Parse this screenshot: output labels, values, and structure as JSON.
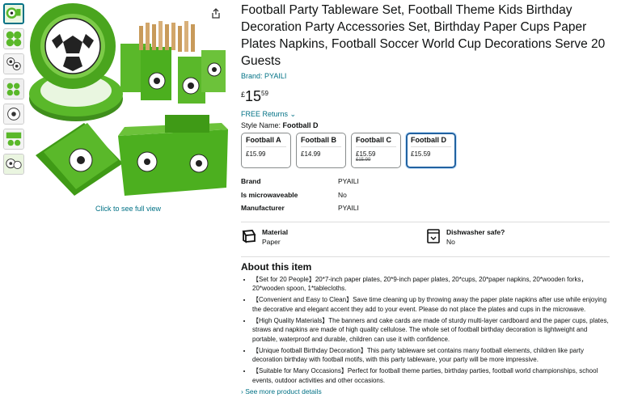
{
  "product": {
    "title": "Football Party Tableware Set, Football Theme Kids Birthday Decoration Party Accessories Set, Birthday Paper Cups Paper Plates Napkins, Football Soccer World Cup Decorations Serve 20 Guests",
    "brand_link": "Brand: PYAILI",
    "price": {
      "symbol": "£",
      "whole": "15",
      "fraction": "59"
    },
    "returns": "FREE Returns ⌄",
    "style_label": "Style Name: ",
    "style_value": "Football D"
  },
  "gallery": {
    "see_full_view": "Click to see full view",
    "thumbnail_count": 7,
    "active_thumbnail": 1
  },
  "options": [
    {
      "name": "Football A",
      "price": "£15.99",
      "was": ""
    },
    {
      "name": "Football B",
      "price": "£14.99",
      "was": ""
    },
    {
      "name": "Football C",
      "price": "£15.59",
      "was": "£15.99"
    },
    {
      "name": "Football D",
      "price": "£15.59",
      "was": ""
    }
  ],
  "specs": [
    {
      "key": "Brand",
      "value": "PYAILI"
    },
    {
      "key": "Is microwaveable",
      "value": "No"
    },
    {
      "key": "Manufacturer",
      "value": "PYAILI"
    }
  ],
  "features": [
    {
      "icon": "material-icon",
      "label": "Material",
      "value": "Paper"
    },
    {
      "icon": "dishwasher-icon",
      "label": "Dishwasher safe?",
      "value": "No"
    }
  ],
  "about": {
    "heading": "About this item",
    "bullets": [
      "【Set for 20 People】20*7-inch paper plates, 20*9-inch paper plates, 20*cups, 20*paper napkins, 20*wooden forks， 20*wooden spoon, 1*tablecloths.",
      "【Convenient and Easy to Clean】Save time cleaning up by throwing away the paper plate napkins after use while enjoying the decorative and elegant accent they add to your event. Please do not place the plates and cups in the microwave.",
      "【High Quality Materials】The banners and cake cards are made of sturdy multi-layer cardboard and the paper cups, plates, straws and napkins are made of high quality cellulose. The whole set of football birthday decoration is lightweight and portable, waterproof and durable, children can use it with confidence.",
      "【Unique football Birthday Decoration】This party tableware set contains many football elements, children like party decoration birthday with football motifs, with this party tableware, your party will be more impressive.",
      "【Suitable for Many Occasions】Perfect for football theme parties, birthday parties, football world championships, school events, outdoor activities and other occasions."
    ],
    "see_more": "› See more product details"
  },
  "colors": {
    "link": "#007185",
    "selected_border": "#2162a1",
    "grass": "#4caf1f"
  }
}
